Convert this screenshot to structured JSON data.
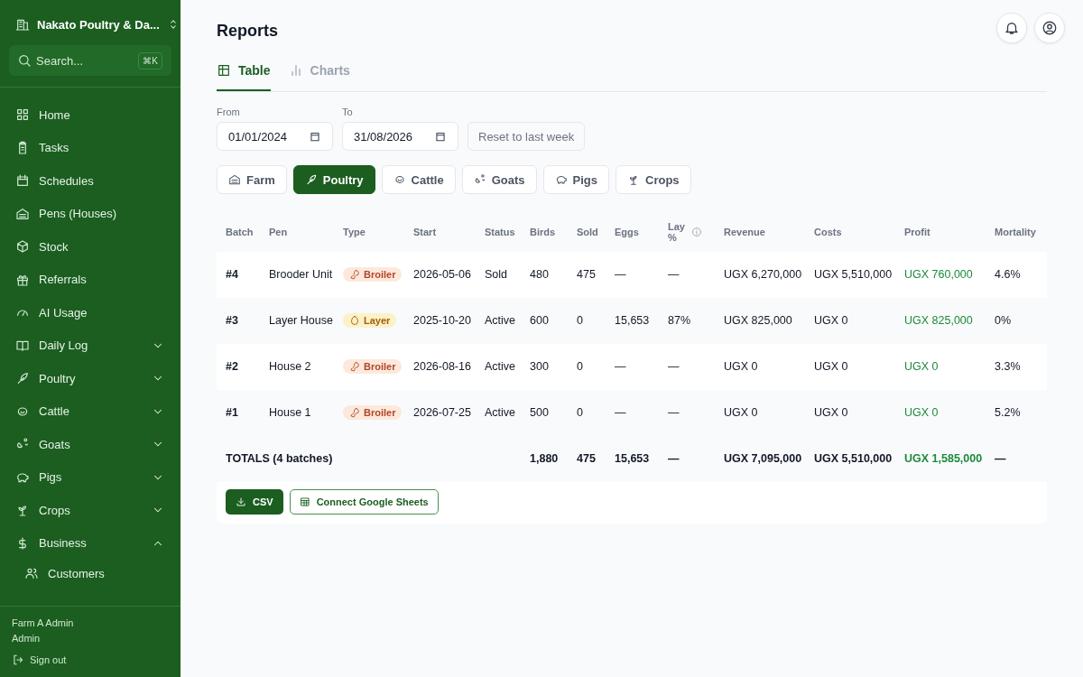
{
  "sidebar": {
    "org_name": "Nakato Poultry & Da...",
    "search": {
      "placeholder": "Search...",
      "shortcut": "⌘K"
    },
    "items": [
      {
        "label": "Home"
      },
      {
        "label": "Tasks"
      },
      {
        "label": "Schedules"
      },
      {
        "label": "Pens (Houses)"
      },
      {
        "label": "Stock"
      },
      {
        "label": "Referrals"
      },
      {
        "label": "AI Usage"
      },
      {
        "label": "Daily Log",
        "expanded": false
      },
      {
        "label": "Poultry",
        "expanded": false
      },
      {
        "label": "Cattle",
        "expanded": false
      },
      {
        "label": "Goats",
        "expanded": false
      },
      {
        "label": "Pigs",
        "expanded": false
      },
      {
        "label": "Crops",
        "expanded": false
      },
      {
        "label": "Business",
        "expanded": true,
        "children": [
          {
            "label": "Customers"
          }
        ]
      }
    ],
    "user": {
      "name": "Farm A Admin",
      "role": "Admin"
    },
    "sign_out": "Sign out"
  },
  "page": {
    "title": "Reports",
    "view_tabs": [
      {
        "label": "Table",
        "selected": true
      },
      {
        "label": "Charts",
        "selected": false
      }
    ],
    "from": {
      "label": "From",
      "value": "01/01/2024"
    },
    "to": {
      "label": "To",
      "value": "31/08/2026"
    },
    "reset": "Reset to last week",
    "species_tabs": [
      {
        "label": "Farm",
        "selected": false
      },
      {
        "label": "Poultry",
        "selected": true
      },
      {
        "label": "Cattle",
        "selected": false
      },
      {
        "label": "Goats",
        "selected": false
      },
      {
        "label": "Pigs",
        "selected": false
      },
      {
        "label": "Crops",
        "selected": false
      }
    ],
    "table": {
      "columns": [
        "Batch",
        "Pen",
        "Type",
        "Start",
        "Status",
        "Birds",
        "Sold",
        "Eggs",
        "Lay %",
        "Revenue",
        "Costs",
        "Profit",
        "Mortality"
      ],
      "rows": [
        {
          "batch": "#4",
          "pen": "Brooder Unit",
          "type": {
            "label": "Broiler",
            "kind": "broiler"
          },
          "start": "2026-05-06",
          "status": "Sold",
          "birds": "480",
          "sold": "475",
          "eggs": "—",
          "lay": "—",
          "revenue": "UGX 6,270,000",
          "costs": "UGX 5,510,000",
          "profit": "UGX 760,000",
          "mortality": "4.6%"
        },
        {
          "batch": "#3",
          "pen": "Layer House",
          "type": {
            "label": "Layer",
            "kind": "layer"
          },
          "start": "2025-10-20",
          "status": "Active",
          "birds": "600",
          "sold": "0",
          "eggs": "15,653",
          "lay": "87%",
          "revenue": "UGX 825,000",
          "costs": "UGX 0",
          "profit": "UGX 825,000",
          "mortality": "0%"
        },
        {
          "batch": "#2",
          "pen": "House 2",
          "type": {
            "label": "Broiler",
            "kind": "broiler"
          },
          "start": "2026-08-16",
          "status": "Active",
          "birds": "300",
          "sold": "0",
          "eggs": "—",
          "lay": "—",
          "revenue": "UGX 0",
          "costs": "UGX 0",
          "profit": "UGX 0",
          "mortality": "3.3%"
        },
        {
          "batch": "#1",
          "pen": "House 1",
          "type": {
            "label": "Broiler",
            "kind": "broiler"
          },
          "start": "2026-07-25",
          "status": "Active",
          "birds": "500",
          "sold": "0",
          "eggs": "—",
          "lay": "—",
          "revenue": "UGX 0",
          "costs": "UGX 0",
          "profit": "UGX 0",
          "mortality": "5.2%"
        }
      ],
      "totals": {
        "label": "TOTALS (4 batches)",
        "birds": "1,880",
        "sold": "475",
        "eggs": "15,653",
        "lay": "—",
        "revenue": "UGX 7,095,000",
        "costs": "UGX 5,510,000",
        "profit": "UGX 1,585,000",
        "mortality": "—"
      }
    },
    "csv_button": "CSV",
    "sheets_button": "Connect Google Sheets"
  }
}
